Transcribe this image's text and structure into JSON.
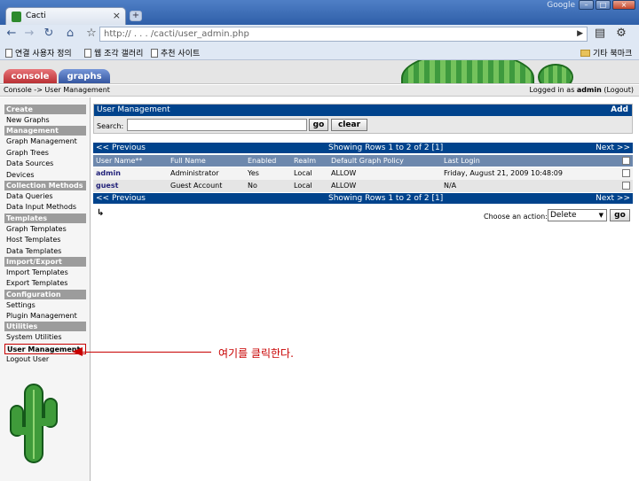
{
  "browser": {
    "tab_title": "Cacti",
    "close_glyph": "×",
    "newtab_glyph": "+",
    "google_label": "Google",
    "window_buttons": [
      "–",
      "□",
      "×"
    ],
    "url": "http://     .     .     .     /cacti/user_admin.php",
    "bookmarks": [
      "연결 사용자 정의",
      "웹 조각 갤러리",
      "추천 사이트"
    ],
    "other_bookmarks": "기타 북마크"
  },
  "cacti": {
    "tabs": [
      "console",
      "graphs"
    ],
    "breadcrumb": "Console -> User Management",
    "login": {
      "prefix": "Logged in as ",
      "user": "admin",
      "logout": "(Logout)"
    }
  },
  "sidebar": {
    "sections": [
      {
        "header": "Create",
        "items": [
          "New Graphs"
        ]
      },
      {
        "header": "Management",
        "items": [
          "Graph Management",
          "Graph Trees",
          "Data Sources",
          "Devices"
        ]
      },
      {
        "header": "Collection Methods",
        "items": [
          "Data Queries",
          "Data Input Methods"
        ]
      },
      {
        "header": "Templates",
        "items": [
          "Graph Templates",
          "Host Templates",
          "Data Templates"
        ]
      },
      {
        "header": "Import/Export",
        "items": [
          "Import Templates",
          "Export Templates"
        ]
      },
      {
        "header": "Configuration",
        "items": [
          "Settings",
          "Plugin Management"
        ]
      },
      {
        "header": "Utilities",
        "items": [
          "System Utilities",
          "User Management",
          "Logout User"
        ]
      }
    ],
    "selected": "User Management"
  },
  "main": {
    "panel_title": "User Management",
    "add_label": "Add",
    "search_label": "Search:",
    "search_value": "",
    "go_label": "go",
    "clear_label": "clear",
    "prev_label": "<< Previous",
    "next_label": "Next >>",
    "showing": "Showing Rows 1 to 2 of 2 [1]",
    "columns": [
      "User Name**",
      "Full Name",
      "Enabled",
      "Realm",
      "Default Graph Policy",
      "Last Login"
    ],
    "rows": [
      [
        "admin",
        "Administrator",
        "Yes",
        "Local",
        "ALLOW",
        "Friday, August 21, 2009 10:48:09"
      ],
      [
        "guest",
        "Guest Account",
        "No",
        "Local",
        "ALLOW",
        "N/A"
      ]
    ],
    "return_arrow": "↳",
    "action_label": "Choose an action:",
    "action_value": "Delete",
    "action_go": "go"
  },
  "annotation": {
    "text": "여기를 클릭한다."
  },
  "colors": {
    "blue_bar": "#00438c",
    "annotation_red": "#c80000"
  }
}
